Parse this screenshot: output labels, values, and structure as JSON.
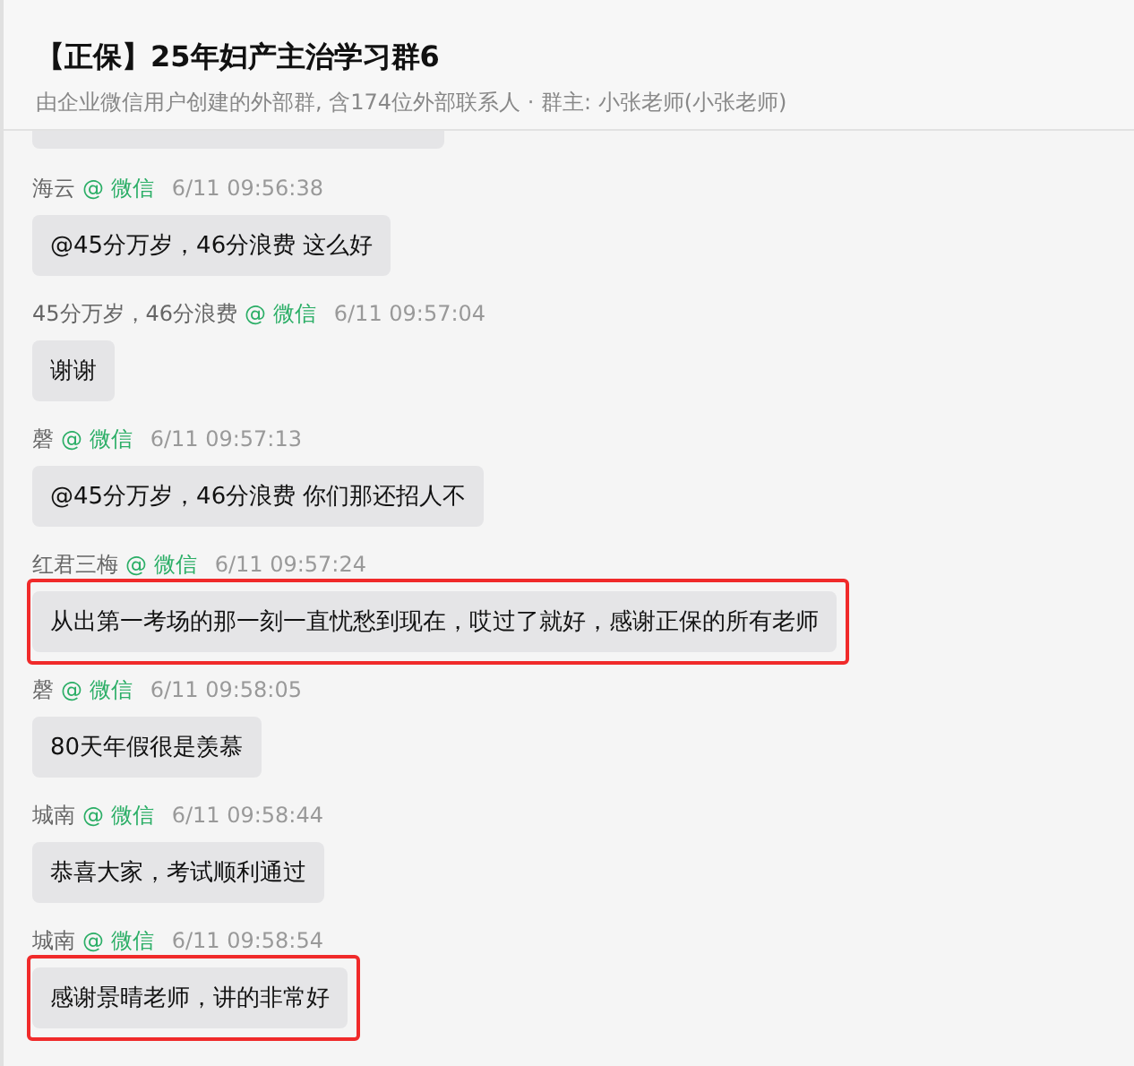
{
  "header": {
    "title": "【正保】25年妇产主治学习群6",
    "subtitle": "由企业微信用户创建的外部群, 含174位外部联系人 · 群主: 小张老师(小张老师)"
  },
  "messages": [
    {
      "sender": "海云",
      "source": "@ 微信",
      "time": "6/11 09:56:38",
      "text": "@45分万岁，46分浪费 这么好",
      "highlighted": false
    },
    {
      "sender": "45分万岁，46分浪费",
      "source": "@ 微信",
      "time": "6/11 09:57:04",
      "text": "谢谢",
      "highlighted": false
    },
    {
      "sender": "磬",
      "source": "@ 微信",
      "time": "6/11 09:57:13",
      "text": "@45分万岁，46分浪费 你们那还招人不",
      "highlighted": false
    },
    {
      "sender": "红君三梅",
      "source": "@ 微信",
      "time": "6/11 09:57:24",
      "text": "从出第一考场的那一刻一直忧愁到现在，哎过了就好，感谢正保的所有老师",
      "highlighted": true
    },
    {
      "sender": "磬",
      "source": "@ 微信",
      "time": "6/11 09:58:05",
      "text": "80天年假很是羡慕",
      "highlighted": false
    },
    {
      "sender": "城南",
      "source": "@ 微信",
      "time": "6/11 09:58:44",
      "text": "恭喜大家，考试顺利通过",
      "highlighted": false
    },
    {
      "sender": "城南",
      "source": "@ 微信",
      "time": "6/11 09:58:54",
      "text": "感谢景晴老师，讲的非常好",
      "highlighted": true
    }
  ]
}
